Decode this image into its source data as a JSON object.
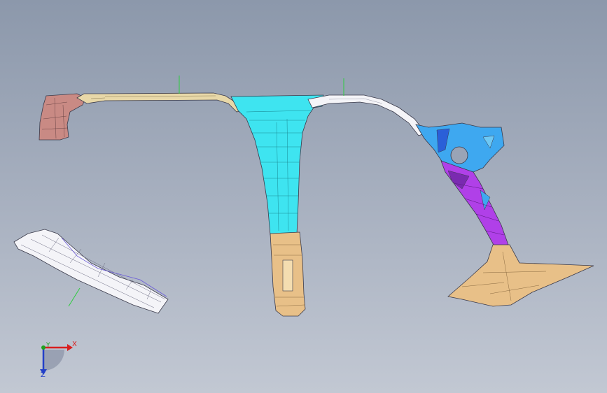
{
  "viewport": {
    "background_top": "#8c98ab",
    "background_bottom": "#c2c8d3"
  },
  "colors": {
    "pink_part": "#c98a84",
    "yellow_trim": "#e8d8a8",
    "cyan_pillar": "#3ee4f0",
    "tan_part": "#e8c088",
    "blue_part": "#2f7fe0",
    "purple_part": "#b040e8",
    "white_part": "#f4f4f8",
    "edge_line": "#3a3a4a",
    "leader_line": "#2ecc40"
  },
  "parts": [
    {
      "name": "front-pillar-lower-trim",
      "color_key": "pink_part"
    },
    {
      "name": "roof-side-rail-front",
      "color_key": "yellow_trim"
    },
    {
      "name": "b-pillar-upper",
      "color_key": "cyan_pillar"
    },
    {
      "name": "b-pillar-lower",
      "color_key": "tan_part"
    },
    {
      "name": "roof-side-rail-rear",
      "color_key": "white_part"
    },
    {
      "name": "c-pillar-upper",
      "color_key": "blue_part"
    },
    {
      "name": "c-pillar-mid",
      "color_key": "purple_part"
    },
    {
      "name": "c-pillar-lower",
      "color_key": "tan_part"
    },
    {
      "name": "a-pillar-trim-exploded",
      "color_key": "white_part"
    }
  ],
  "triad": {
    "x_label": "X",
    "y_label": "Y",
    "z_label": "Z",
    "x_color": "#d81e1e",
    "y_color": "#1ea31e",
    "z_color": "#2340c8"
  }
}
